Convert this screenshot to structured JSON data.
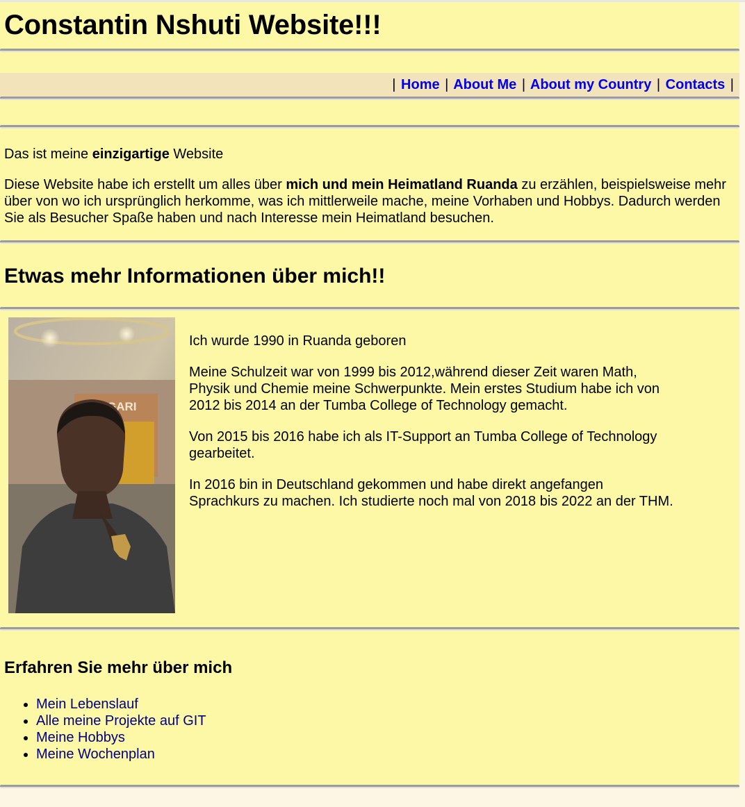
{
  "header": {
    "title": "Constantin Nshuti Website!!!"
  },
  "nav": {
    "separator": "|",
    "items": [
      {
        "label": "Home"
      },
      {
        "label": "About Me"
      },
      {
        "label": "About my Country"
      },
      {
        "label": "Contacts"
      }
    ]
  },
  "intro": {
    "line1_prefix": "Das ist meine ",
    "line1_bold": "einzigartige",
    "line1_suffix": " Website",
    "p2_prefix": "Diese Website habe ich erstellt um alles über ",
    "p2_bold": "mich und mein Heimatland Ruanda",
    "p2_suffix": " zu erzählen, beispielsweise mehr über von wo ich ursprünglich herkomme, was ich mittlerweile mache, meine Vorhaben und Hobbys. Dadurch werden Sie als Besucher Spaße haben und nach Interesse mein Heimatland besuchen."
  },
  "section_heading": "Etwas mehr Informationen über mich!!",
  "about": {
    "paragraphs": [
      "Ich wurde 1990 in Ruanda geboren",
      "Meine Schulzeit war von 1999 bis 2012,während dieser Zeit waren Math, Physik und Chemie meine Schwerpunkte. Mein erstes Studium habe ich von 2012 bis 2014 an der Tumba College of Technology gemacht.",
      "Von 2015 bis 2016 habe ich als IT-Support an Tumba College of Technology gearbeitet.",
      "In 2016 bin in Deutschland gekommen und habe direkt angefangen Sprachkurs zu machen. Ich studierte noch mal von 2018 bis 2022 an der THM."
    ],
    "photo_sign_text": "BVLGARI"
  },
  "more": {
    "heading": "Erfahren Sie mehr über mich",
    "links": [
      {
        "label": "Mein Lebenslauf"
      },
      {
        "label": "Alle meine Projekte auf GIT"
      },
      {
        "label": "Meine Hobbys"
      },
      {
        "label": "Meine Wochenplan"
      }
    ]
  },
  "colors": {
    "page_bg": "#fcf8a6",
    "nav_bg": "#f2e3bb",
    "nav_link": "#0000ee",
    "list_link": "#000080"
  }
}
